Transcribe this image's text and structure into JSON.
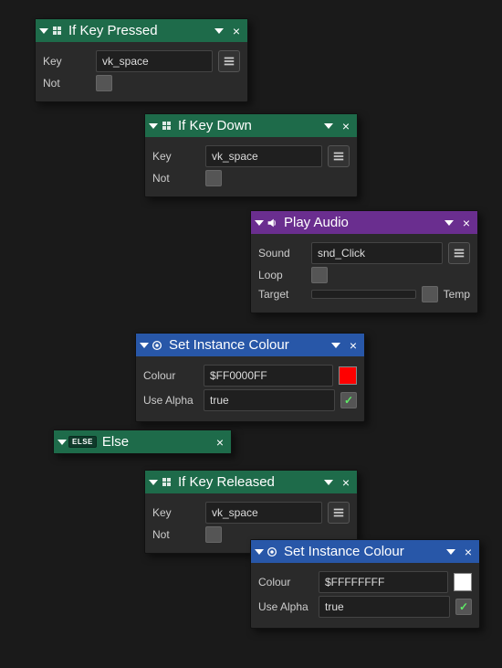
{
  "nodes": {
    "ifKeyPressed": {
      "title": "If Key Pressed",
      "keyLabel": "Key",
      "keyValue": "vk_space",
      "notLabel": "Not"
    },
    "ifKeyDown": {
      "title": "If Key Down",
      "keyLabel": "Key",
      "keyValue": "vk_space",
      "notLabel": "Not"
    },
    "playAudio": {
      "title": "Play Audio",
      "soundLabel": "Sound",
      "soundValue": "snd_Click",
      "loopLabel": "Loop",
      "targetLabel": "Target",
      "targetValue": "",
      "tempLabel": "Temp"
    },
    "setColour1": {
      "title": "Set Instance Colour",
      "colourLabel": "Colour",
      "colourValue": "$FF0000FF",
      "swatch": "#ff0000",
      "useAlphaLabel": "Use Alpha",
      "useAlphaValue": "true"
    },
    "elseNode": {
      "tag": "ELSE",
      "title": "Else"
    },
    "ifKeyReleased": {
      "title": "If Key Released",
      "keyLabel": "Key",
      "keyValue": "vk_space",
      "notLabel": "Not"
    },
    "setColour2": {
      "title": "Set Instance Colour",
      "colourLabel": "Colour",
      "colourValue": "$FFFFFFFF",
      "swatch": "#ffffff",
      "useAlphaLabel": "Use Alpha",
      "useAlphaValue": "true"
    }
  }
}
